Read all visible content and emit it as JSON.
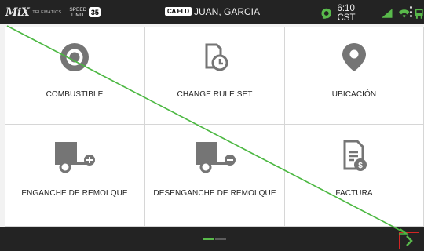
{
  "statusbar": {
    "logo": "MiX",
    "logo_sub": "TELEMATICS",
    "speed_limit_label": "SPEED LIMIT",
    "speed_limit_value": "35",
    "eld_badge": "CA ELD",
    "driver_name": "JUAN, GARCIA",
    "time": "6:10 CST",
    "icons": [
      "drive-status-icon",
      "signal-icon",
      "wifi-icon",
      "truck-icon",
      "more-vert-icon"
    ]
  },
  "tiles": [
    {
      "label": "COMBUSTIBLE",
      "icon": "fuel-target-icon"
    },
    {
      "label": "CHANGE RULE SET",
      "icon": "rule-clock-icon"
    },
    {
      "label": "UBICACIÓN",
      "icon": "location-pin-icon"
    },
    {
      "label": "ENGANCHE DE REMOLQUE",
      "icon": "trailer-hook-icon"
    },
    {
      "label": "DESENGANCHE DE REMOLQUE",
      "icon": "trailer-unhook-icon"
    },
    {
      "label": "FACTURA",
      "icon": "invoice-icon"
    }
  ],
  "pager": {
    "pages": 2,
    "current": 1
  },
  "colors": {
    "accent": "#59b94b",
    "icon": "#757575",
    "bar": "#232323",
    "highlight": "#d32424"
  }
}
